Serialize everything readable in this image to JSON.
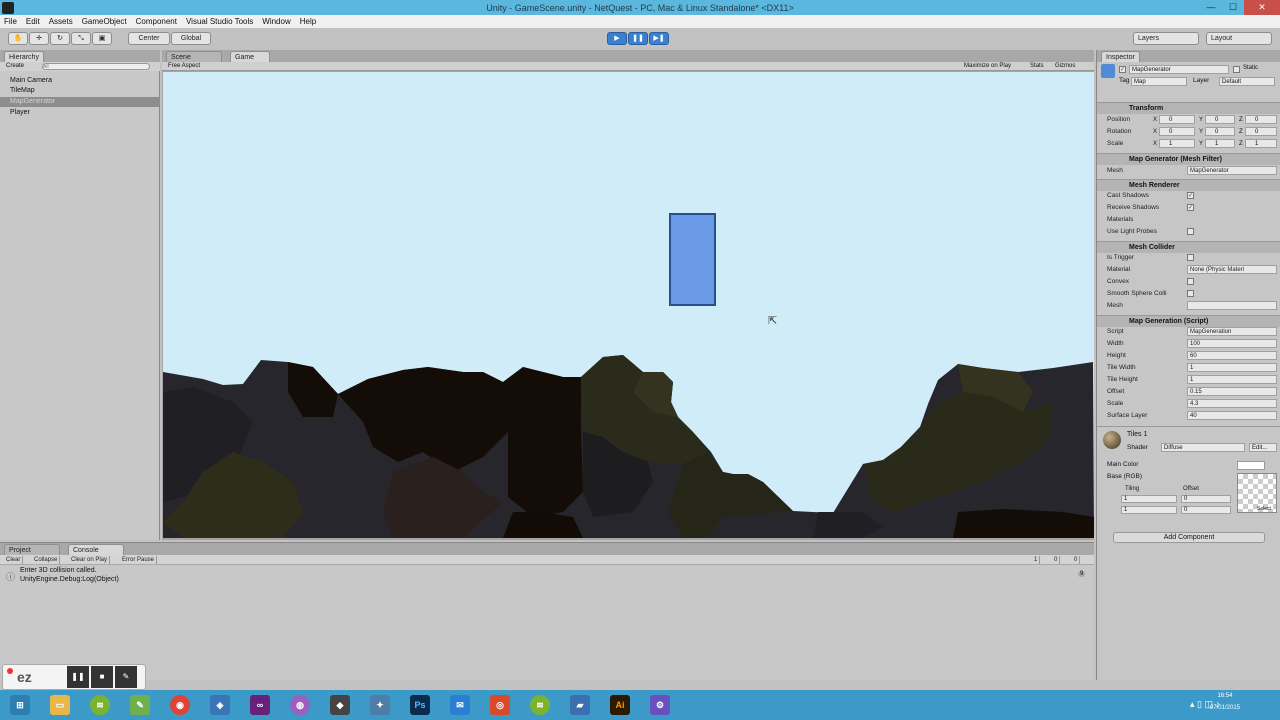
{
  "window": {
    "title": "Unity - GameScene.unity - NetQuest - PC, Mac & Linux Standalone* <DX11>"
  },
  "menu": [
    "File",
    "Edit",
    "Assets",
    "GameObject",
    "Component",
    "Visual Studio Tools",
    "Window",
    "Help"
  ],
  "toolbar": {
    "pivot": "Center",
    "space": "Global",
    "layers": "Layers",
    "layout": "Layout"
  },
  "hierarchy": {
    "tab": "Hierarchy",
    "create": "Create",
    "search_placeholder": "All",
    "items": [
      "Main Camera",
      "TileMap",
      "MapGenerator",
      "Player"
    ]
  },
  "game": {
    "tab_scene": "Scene",
    "tab_game": "Game",
    "aspect": "Free Aspect",
    "maximize": "Maximize on Play",
    "stats": "Stats",
    "gizmos": "Gizmos"
  },
  "console": {
    "tab_project": "Project",
    "tab_console": "Console",
    "buttons": [
      "Clear",
      "Collapse",
      "Clear on Play",
      "Error Pause"
    ],
    "counts": [
      "1",
      "0",
      "0"
    ],
    "log_line1": "Enter 3D collision called.",
    "log_line2": "UnityEngine.Debug:Log(Object)",
    "log_count": "9"
  },
  "inspector": {
    "tab": "Inspector",
    "object_name": "MapGenerator",
    "static": "Static",
    "tag_label": "Tag",
    "tag": "Map",
    "layer_label": "Layer",
    "layer": "Default",
    "transform": {
      "header": "Transform",
      "position_label": "Position",
      "rotation_label": "Rotation",
      "scale_label": "Scale",
      "position": [
        "0",
        "0",
        "0"
      ],
      "rotation": [
        "0",
        "0",
        "0"
      ],
      "scale": [
        "1",
        "1",
        "1"
      ]
    },
    "mesh_filter": {
      "header": "Map Generator (Mesh Filter)",
      "mesh_label": "Mesh",
      "mesh": "MapGenerator"
    },
    "mesh_renderer": {
      "header": "Mesh Renderer",
      "cast_shadows": "Cast Shadows",
      "receive_shadows": "Receive Shadows",
      "materials": "Materials",
      "use_light_probes": "Use Light Probes"
    },
    "mesh_collider": {
      "header": "Mesh Collider",
      "is_trigger": "Is Trigger",
      "material_label": "Material",
      "material": "None (Physic Materi",
      "convex": "Convex",
      "smooth": "Smooth Sphere Colli",
      "mesh_label": "Mesh",
      "mesh": ""
    },
    "map_generation": {
      "header": "Map Generation (Script)",
      "fields": [
        {
          "label": "Script",
          "value": "MapGeneration"
        },
        {
          "label": "Width",
          "value": "100"
        },
        {
          "label": "Height",
          "value": "60"
        },
        {
          "label": "Tile Width",
          "value": "1"
        },
        {
          "label": "Tile Height",
          "value": "1"
        },
        {
          "label": "Offset",
          "value": "0.15"
        },
        {
          "label": "Scale",
          "value": "4.3"
        },
        {
          "label": "Surface Layer",
          "value": "40"
        }
      ]
    },
    "material": {
      "name": "Tiles 1",
      "shader_label": "Shader",
      "shader": "Diffuse",
      "edit": "Edit...",
      "main_color": "Main Color",
      "base_rgb": "Base (RGB)",
      "tiling": "Tiling",
      "offset": "Offset",
      "tiling_x": "1",
      "tiling_y": "1",
      "offset_x": "0",
      "offset_y": "0",
      "select": "Select"
    },
    "add_component": "Add Component"
  },
  "taskbar": {
    "time": "16:54",
    "date": "07/01/2015",
    "apps": [
      "explorer",
      "spotify",
      "notepad",
      "chrome",
      "app",
      "visual-studio",
      "app2",
      "unity",
      "app3",
      "photoshop",
      "mail",
      "app4",
      "spotify2",
      "app5",
      "illustrator",
      "settings"
    ]
  },
  "recorder": {
    "brand": "ez"
  },
  "colors": {
    "sky": "#d0ecf8",
    "player": "#6b9be6",
    "titlebar": "#5bb7dd",
    "taskbar": "#3b9ac8"
  }
}
